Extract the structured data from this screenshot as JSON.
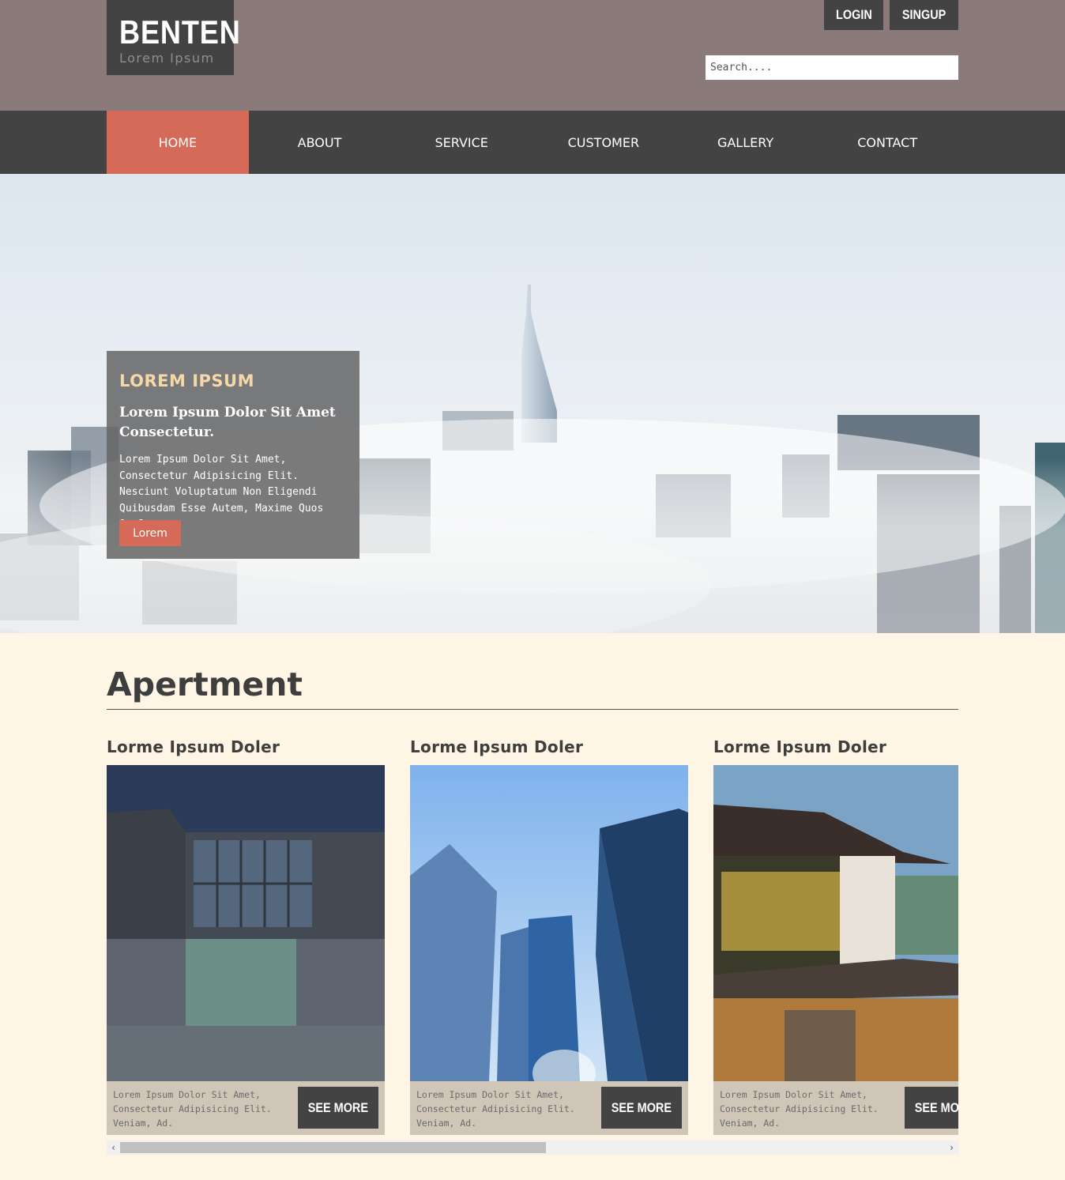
{
  "header": {
    "logo_title": "BENTEN",
    "logo_subtitle": "Lorem Ipsum",
    "login_label": "LOGIN",
    "signup_label": "SINGUP",
    "search_placeholder": "Search...."
  },
  "nav": {
    "items": [
      {
        "label": "HOME",
        "active": true
      },
      {
        "label": "ABOUT"
      },
      {
        "label": "SERVICE"
      },
      {
        "label": "CUSTOMER"
      },
      {
        "label": "GALLERY"
      },
      {
        "label": "CONTACT"
      }
    ]
  },
  "hero": {
    "kicker": "LOREM IPSUM",
    "heading": "Lorem Ipsum Dolor Sit Amet Consectetur.",
    "text": "Lorem Ipsum Dolor Sit Amet, Consectetur Adipisicing Elit. Nesciunt Voluptatum Non Eligendi Quibusdam Esse Autem, Maxime Quos Quo?",
    "button_label": "Lorem"
  },
  "section": {
    "title": "Apertment",
    "cards": [
      {
        "title": "Lorme Ipsum Doler",
        "desc": "Lorem Ipsum Dolor Sit Amet, Consectetur Adipisicing Elit. Veniam, Ad.",
        "button": "SEE MORE"
      },
      {
        "title": "Lorme Ipsum Doler",
        "desc": "Lorem Ipsum Dolor Sit Amet, Consectetur Adipisicing Elit. Veniam, Ad.",
        "button": "SEE MORE"
      },
      {
        "title": "Lorme Ipsum Doler",
        "desc": "Lorem Ipsum Dolor Sit Amet, Consectetur Adipisicing Elit. Veniam, Ad.",
        "button": "SEE MORE"
      }
    ]
  },
  "scrollbar": {
    "left_icon": "chevron-left-icon",
    "right_icon": "chevron-right-icon",
    "left_glyph": "‹",
    "right_glyph": "›"
  },
  "colors": {
    "header_bg": "#8a7a7a",
    "nav_bg": "#434343",
    "accent": "#d66a58",
    "page_bg": "#fff5e5",
    "kicker": "#f5d8a8",
    "card_footer": "#cfc6b8"
  }
}
